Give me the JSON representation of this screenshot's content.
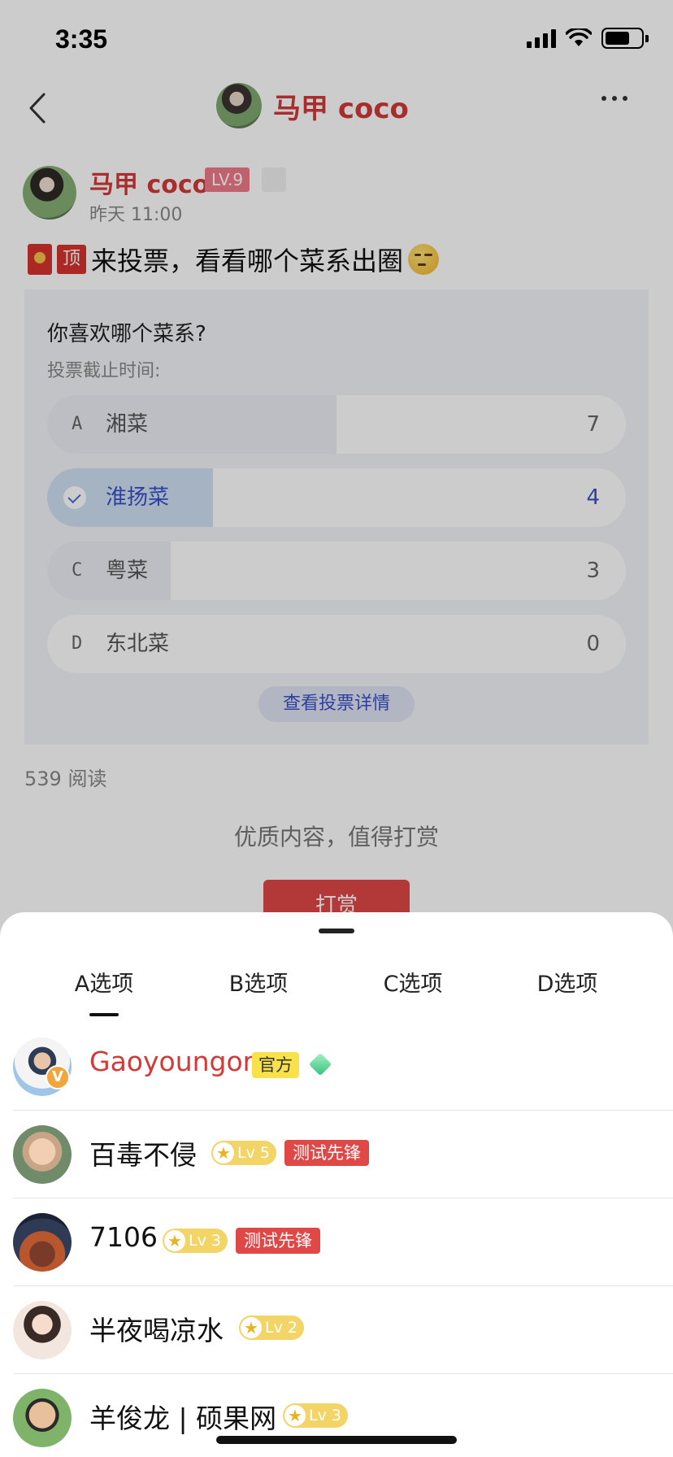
{
  "status_bar": {
    "time": "3:35"
  },
  "header": {
    "title": "马甲 coco"
  },
  "post": {
    "author_name": "马甲 coco",
    "level": "LV.9",
    "time": "昨天 11:00",
    "top_tag": "顶",
    "title": "来投票，看看哪个菜系出圈",
    "read_count": "539 阅读",
    "reward_text": "优质内容，值得打赏",
    "reward_button": "打赏"
  },
  "vote": {
    "question": "你喜欢哪个菜系?",
    "deadline": "投票截止时间:",
    "options": [
      {
        "letter": "A",
        "label": "湘菜",
        "count": "7",
        "fill": 0.5
      },
      {
        "letter": "B",
        "label": "淮扬菜",
        "count": "4",
        "fill": 0.286,
        "selected": true
      },
      {
        "letter": "C",
        "label": "粤菜",
        "count": "3",
        "fill": 0.214
      },
      {
        "letter": "D",
        "label": "东北菜",
        "count": "0",
        "fill": 0
      }
    ],
    "detail_button": "查看投票详情"
  },
  "sheet": {
    "tabs": [
      "A选项",
      "B选项",
      "C选项",
      "D选项"
    ],
    "active_tab": 0,
    "voters": [
      {
        "name": "Gaoyoungor",
        "tag": "官方"
      },
      {
        "name": "百毒不侵",
        "level": "Lv 5",
        "tag": "测试先锋"
      },
      {
        "name": "7106",
        "level": "Lv 3",
        "tag": "测试先锋"
      },
      {
        "name": "半夜喝凉水",
        "level": "Lv 2"
      },
      {
        "name": "羊俊龙 | 硕果网",
        "level": "Lv 3"
      }
    ]
  },
  "colors": {
    "accent_red": "#d23a3a",
    "vote_blue": "#3a4fc8",
    "level_gold": "#f3d466"
  }
}
